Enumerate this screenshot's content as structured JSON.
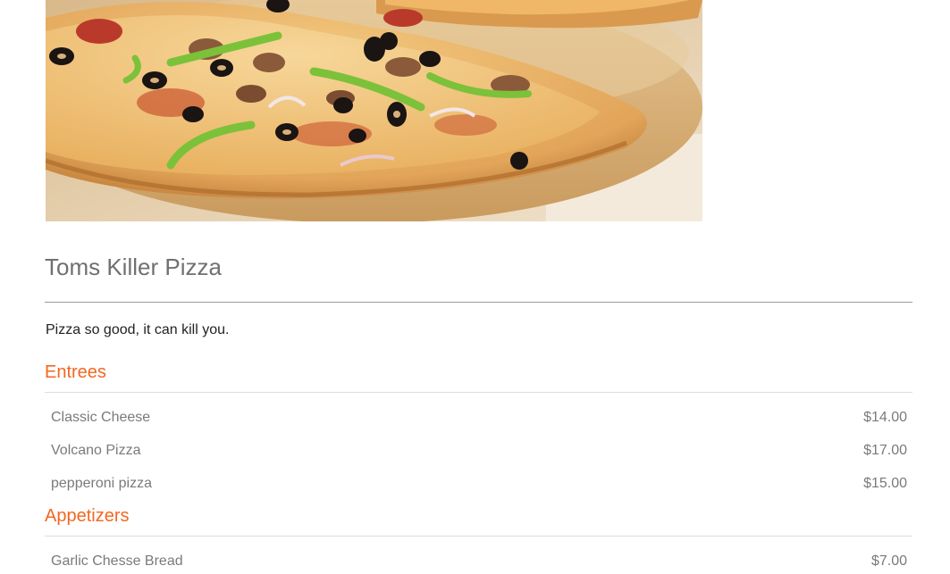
{
  "restaurant": {
    "name": "Toms Killer Pizza",
    "tagline": "Pizza so good, it can kill you.",
    "hero_image": "pizza-photo"
  },
  "colors": {
    "accent": "#f26722",
    "title": "#707070",
    "item_text": "#7a7a7a"
  },
  "menu": {
    "sections": [
      {
        "title": "Entrees",
        "items": [
          {
            "name": "Classic Cheese",
            "price": "$14.00"
          },
          {
            "name": "Volcano Pizza",
            "price": "$17.00"
          },
          {
            "name": "pepperoni pizza",
            "price": "$15.00"
          }
        ]
      },
      {
        "title": "Appetizers",
        "items": [
          {
            "name": "Garlic Chesse Bread",
            "price": "$7.00"
          }
        ]
      }
    ]
  }
}
